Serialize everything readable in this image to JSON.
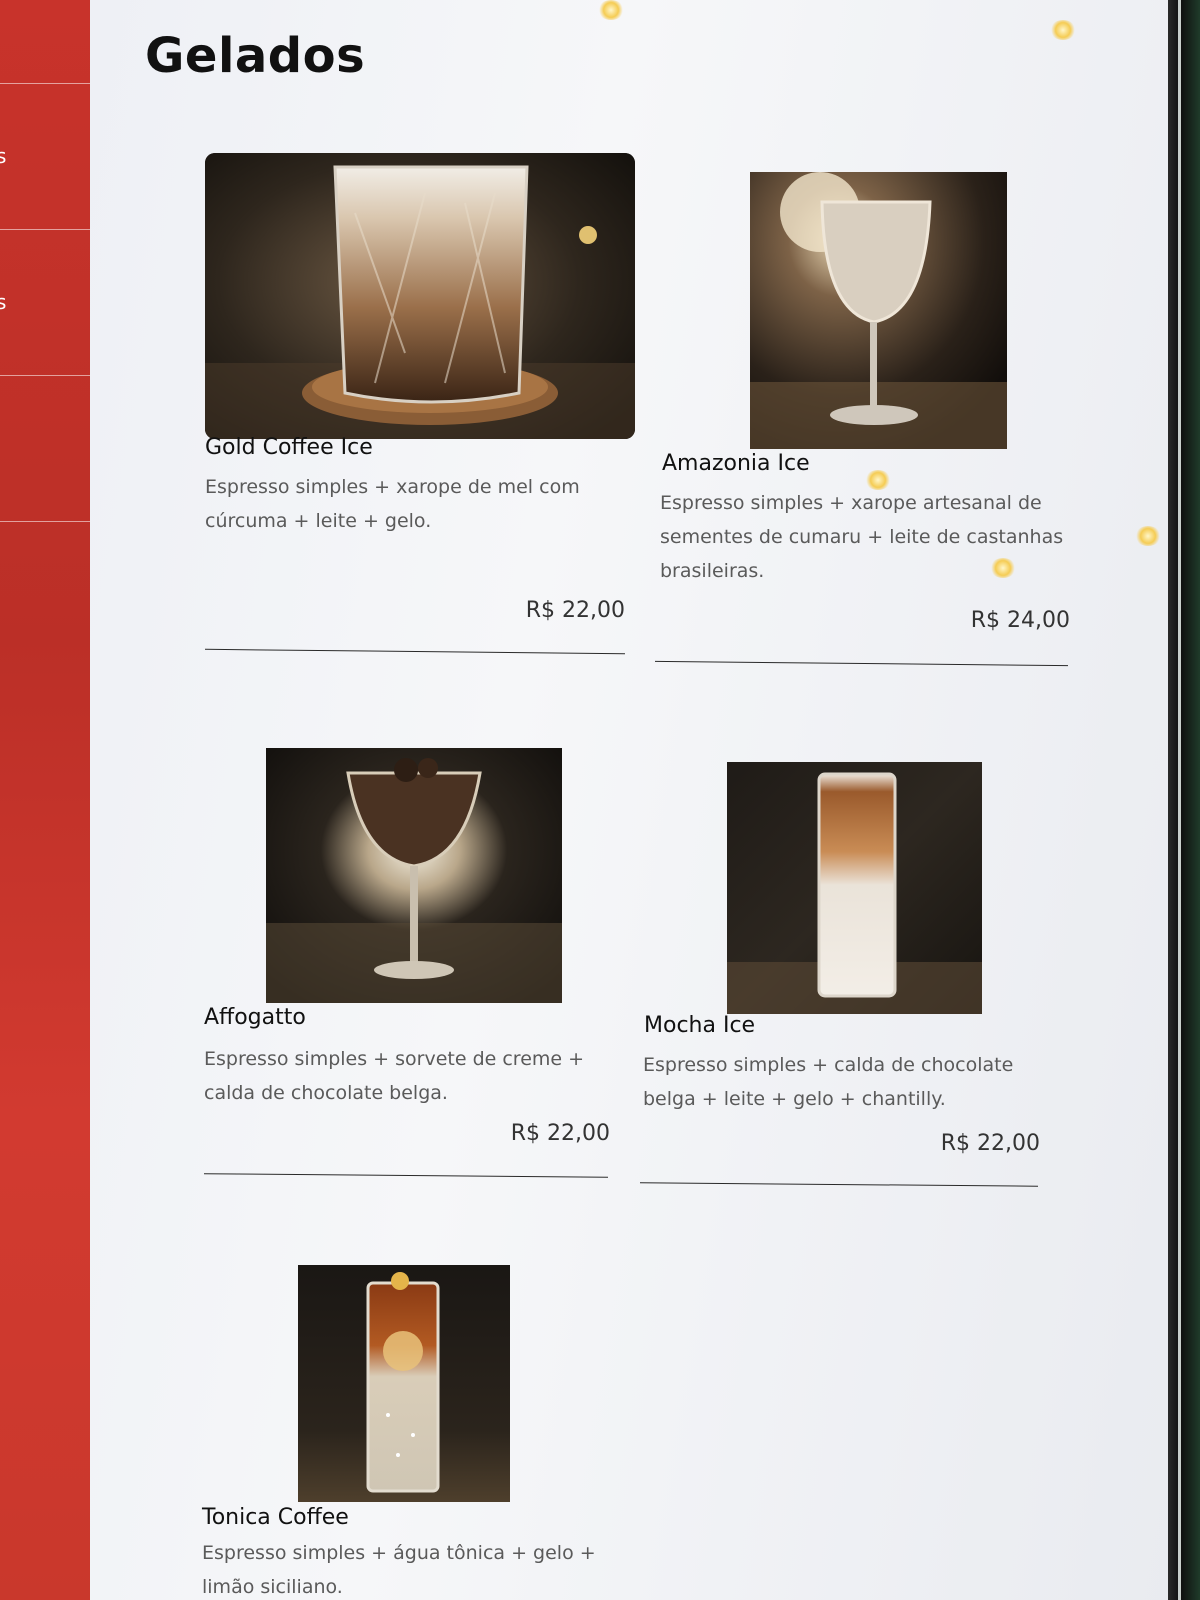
{
  "sidebar": {
    "items": [
      {
        "label": ""
      },
      {
        "label": "s"
      },
      {
        "label": "s"
      },
      {
        "label": ""
      },
      {
        "label": ""
      }
    ]
  },
  "section": {
    "title": "Gelados"
  },
  "items": [
    {
      "name": "Gold Coffee Ice",
      "description": "Espresso simples + xarope de mel com cúrcuma + leite + gelo.",
      "price": "R$ 22,00",
      "photo_icon": "iced-latte-glass-photo"
    },
    {
      "name": "Amazonia Ice",
      "description": "Espresso simples + xarope artesanal de sementes de cumaru + leite de castanhas brasileiras.",
      "price": "R$ 24,00",
      "photo_icon": "wine-glass-drink-photo"
    },
    {
      "name": "Affogatto",
      "description": "Espresso simples + sorvete de creme + calda de chocolate belga.",
      "price": "R$ 22,00",
      "photo_icon": "margarita-glass-dessert-photo"
    },
    {
      "name": "Mocha Ice",
      "description": "Espresso simples + calda de chocolate belga + leite + gelo + chantilly.",
      "price": "R$ 22,00",
      "photo_icon": "tall-layered-glass-photo"
    },
    {
      "name": "Tonica Coffee",
      "description": "Espresso simples + água tônica + gelo + limão siciliano.",
      "price": "",
      "photo_icon": "tonic-highball-glass-photo"
    }
  ],
  "colors": {
    "sidebar_red": "#c8332b",
    "panel_background": "#eef0f5",
    "title_text": "#111111",
    "description_text": "#5a5a5a"
  }
}
